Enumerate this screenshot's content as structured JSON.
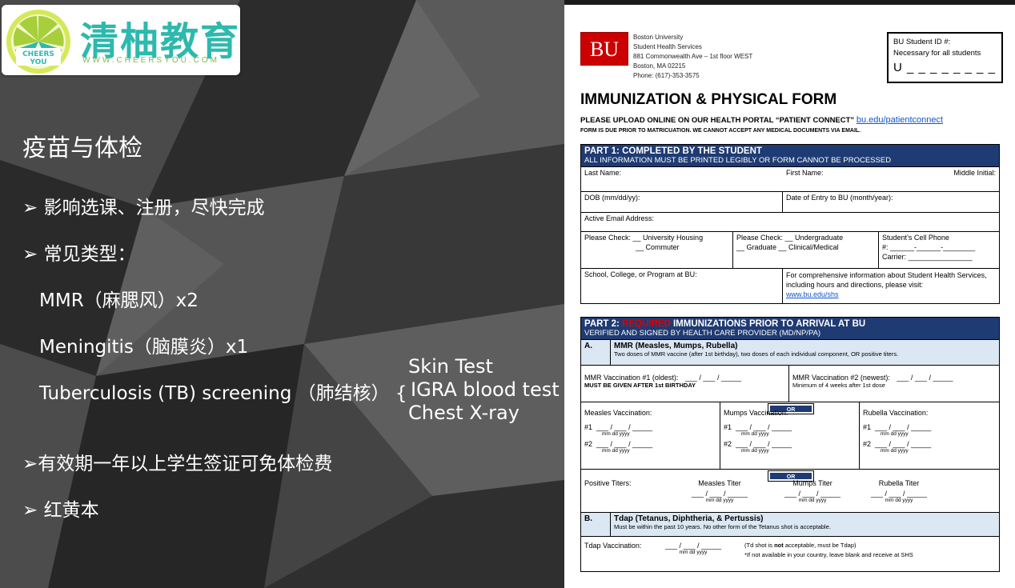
{
  "logo": {
    "badge_text": "CHEERS YOU",
    "brand": "清柚教育",
    "url": "WWW.CHEERSYOU.COM"
  },
  "left": {
    "title": "疫苗与体检",
    "bullet1": "➢ 影响选课、注册，尽快完成",
    "bullet2": "➢ 常见类型：",
    "item1": "MMR（麻腮风）x2",
    "item2": "Meningitis（脑膜炎）x1",
    "item3": "Tuberculosis (TB) screening （肺结核） {",
    "tb_options": [
      "Skin Test",
      "IGRA blood test",
      "Chest X-ray"
    ],
    "bullet3": "➢有效期一年以上学生签证可免体检费",
    "bullet4": "➢ 红黄本"
  },
  "form": {
    "bu_logo": "BU",
    "address": [
      "Boston University",
      "Student Health Services",
      "881 Commonwealth Ave – 1st floor WEST",
      "Boston, MA 02215",
      "Phone: (617)-353-3575"
    ],
    "id_label": "BU Student ID #:",
    "id_note": "Necessary for all students",
    "id_field": "U _ _ _ _ _ _ _ _",
    "title": "IMMUNIZATION & PHYSICAL FORM",
    "upload_note": "PLEASE UPLOAD ONLINE ON OUR HEALTH PORTAL “PATIENT CONNECT”",
    "upload_link": "bu.edu/patientconnect",
    "due_note": "FORM IS DUE PRIOR TO MATRICUATION.  WE CANNOT ACCEPT ANY MEDICAL DOCUMENTS VIA EMAIL.",
    "part1": {
      "title": "PART 1: COMPLETED BY THE STUDENT",
      "subtitle": "ALL INFORMATION MUST BE PRINTED LEGIBLY OR FORM CANNOT BE PROCESSED",
      "last_name": "Last Name:",
      "first_name": "First Name:",
      "middle": "Middle Initial:",
      "dob": "DOB (mm/dd/yy):",
      "entry": "Date of Entry to BU (month/year):",
      "email": "Active Email Address:",
      "check1a": "Please Check: __ University Housing",
      "check1b": "__ Commuter",
      "check2a": "Please Check: __ Undergraduate",
      "check2b": "__ Graduate   __ Clinical/Medical",
      "cell_a": "Student’s Cell Phone",
      "cell_b": "#: ______-______-________",
      "cell_c": "Carrier: ________________",
      "school": "School, College, or Program at BU:",
      "info": "For comprehensive information about Student Health Services, including hours and directions, please visit:",
      "info_link": "www.bu.edu/shs"
    },
    "part2": {
      "title_a": "PART 2: ",
      "title_red": "REQUIRED",
      "title_b": " IMMUNIZATIONS PRIOR TO ARRIVAL AT BU",
      "subtitle": "VERIFIED AND SIGNED BY HEALTH CARE PROVIDER (MD/NP/PA)",
      "a_letter": "A.",
      "a_title": "MMR (Measles, Mumps, Rubella)",
      "a_desc": "Two doses of MMR vaccine (after 1st birthday), two doses of each individual component, OR positive titers.",
      "mmr1": "MMR Vaccination #1 (oldest):",
      "mmr1_note": "MUST BE GIVEN AFTER 1st BIRTHDAY",
      "mmr2": "MMR Vaccination #2 (newest):",
      "mmr2_note": "Minimum of 4 weeks after 1st dose",
      "date_blank": "___ / ___ / _____",
      "date_units": "mm        dd        yyyy",
      "or": "OR",
      "measles": "Measles Vaccination:",
      "mumps": "Mumps Vaccination:",
      "rubella": "Rubella Vaccination:",
      "dose1": "#1",
      "dose2": "#2",
      "titers": "Positive Titers:",
      "measles_titer": "Measles Titer",
      "mumps_titer": "Mumps Titer",
      "rubella_titer": "Rubella Titer",
      "b_letter": "B.",
      "b_title": "Tdap (Tetanus, Diphtheria, & Pertussis)",
      "b_desc": "Must be within the past 10 years. No other form of the Tetanus shot is acceptable.",
      "tdap": "Tdap Vaccination:",
      "td_note_a": "(Td shot is ",
      "td_note_not": "not",
      "td_note_b": " acceptable, must be Tdap)",
      "td_note2": "*If not available in your country, leave blank and receive at SHS"
    }
  }
}
